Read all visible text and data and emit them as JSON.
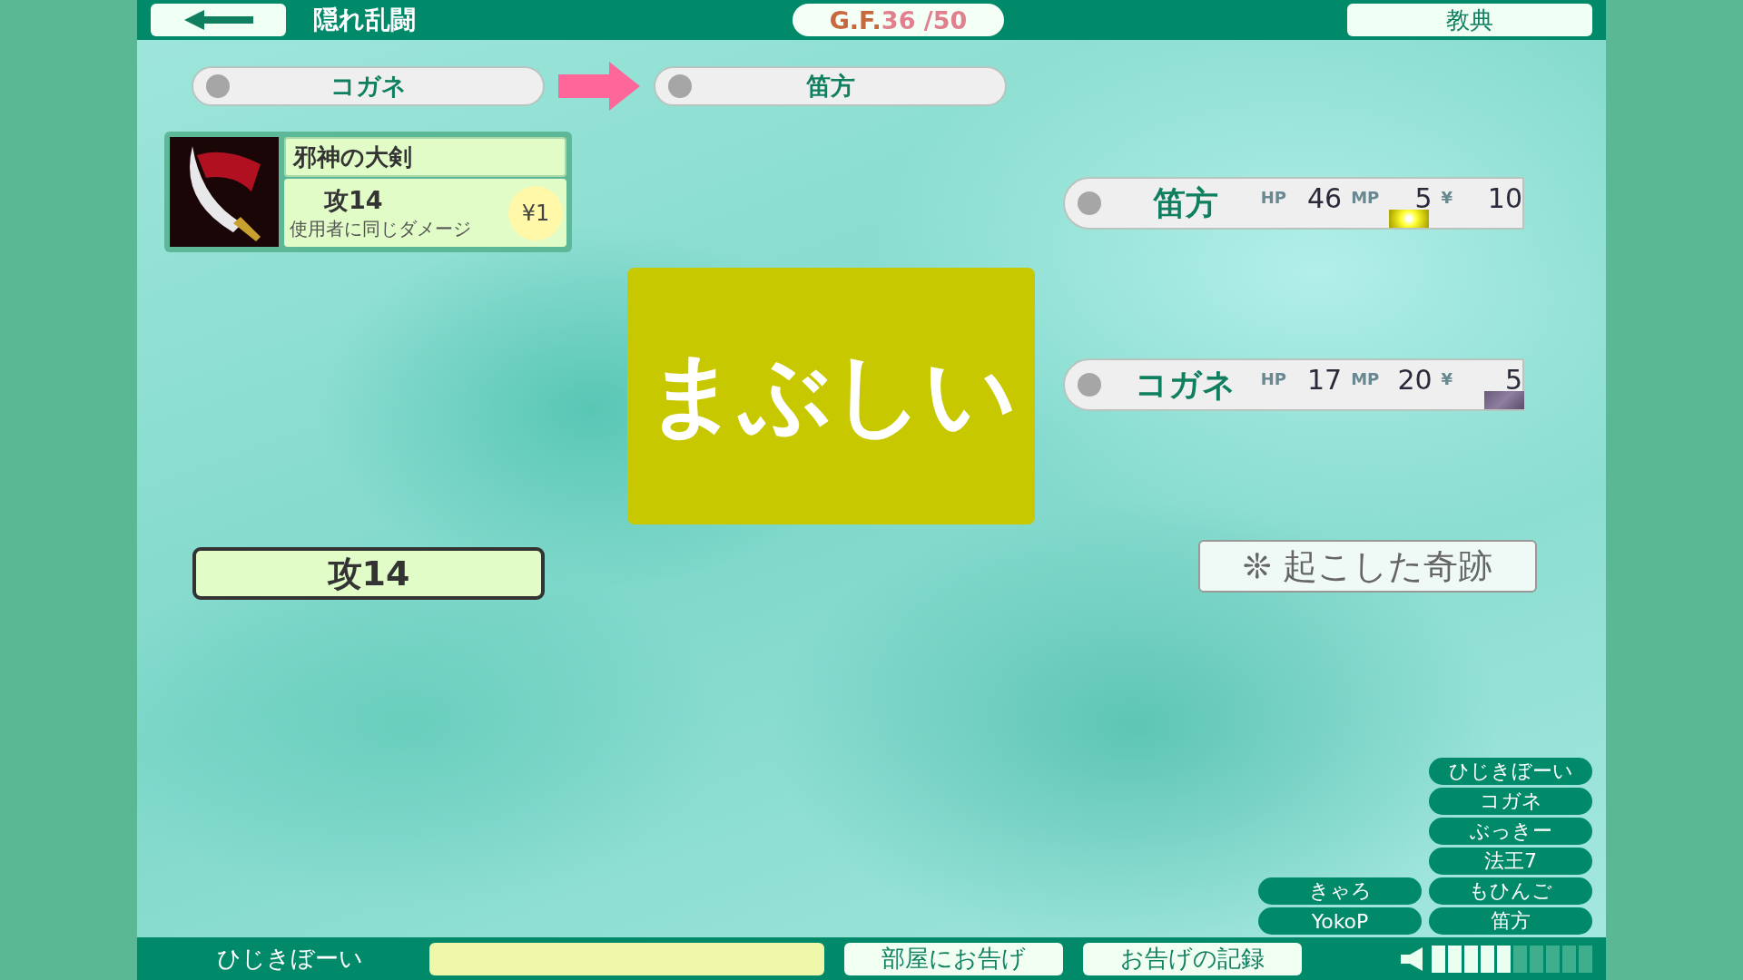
{
  "header": {
    "title": "隠れ乱闘",
    "counter": {
      "label": "G.F.",
      "value": "36 /50"
    },
    "book_button": "教典"
  },
  "turn": [
    {
      "name": "コガネ"
    },
    {
      "name": "笛方"
    }
  ],
  "card": {
    "name": "邪神の大剣",
    "attack": "攻14",
    "effect": "使用者に同じダメージ",
    "cost": "¥1"
  },
  "effect_banner": "まぶしい",
  "result": "攻14",
  "players": [
    {
      "name": "笛方",
      "stats": [
        {
          "label": "HP",
          "value": "46",
          "kind": "plain"
        },
        {
          "label": "MP",
          "value": "5",
          "kind": "sparkle"
        },
        {
          "label": "¥",
          "value": "10",
          "kind": "plain"
        }
      ]
    },
    {
      "name": "コガネ",
      "stats": [
        {
          "label": "HP",
          "value": "17",
          "kind": "plain"
        },
        {
          "label": "MP",
          "value": "20",
          "kind": "plain"
        },
        {
          "label": "¥",
          "value": "5",
          "kind": "haze"
        }
      ]
    }
  ],
  "miracle_button": "❊ 起こした奇跡",
  "members": [
    [
      "きゃろ",
      "YokoP"
    ],
    [
      "ひじきぼーい",
      "コガネ",
      "ぶっきー",
      "法王7",
      "もひんご",
      "笛方"
    ]
  ],
  "footer": {
    "user": "ひじきぼーい",
    "buttons": [
      "部屋にお告げ",
      "お告げの記録"
    ],
    "volume": {
      "level": 0.5
    }
  }
}
